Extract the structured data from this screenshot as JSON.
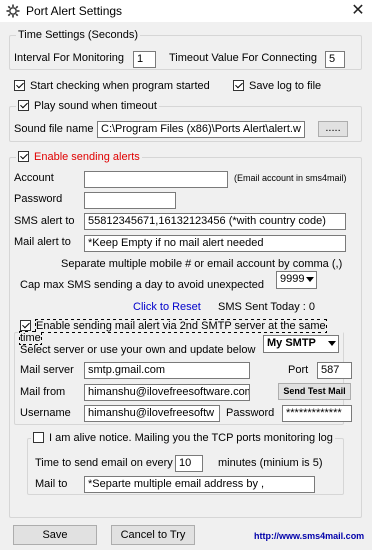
{
  "window": {
    "title": "Port Alert  Settings",
    "close_glyph": "✕"
  },
  "time_settings": {
    "legend": "Time Settings (Seconds)",
    "interval_label": "Interval For Monitoring",
    "interval_value": "1",
    "timeout_label": "Timeout Value For Connecting",
    "timeout_value": "5"
  },
  "options": {
    "start_checking_label": "Start checking when program started",
    "start_checking_checked": true,
    "save_log_label": "Save log to file",
    "save_log_checked": true
  },
  "sound": {
    "legend": "Play sound when timeout",
    "checked": true,
    "file_label": "Sound file name",
    "file_value": "C:\\Program Files (x86)\\Ports Alert\\alert.w",
    "browse_label": "....."
  },
  "alerts": {
    "legend": "Enable sending alerts",
    "checked": true,
    "account_label": "Account",
    "account_value": "",
    "account_hint": "(Email account in sms4mail)",
    "password_label": "Password",
    "password_value": "",
    "sms_label": "SMS alert to",
    "sms_value": "55812345671,16132123456 (*with country code)",
    "mail_label": "Mail alert to",
    "mail_value": "*Keep Empty if no mail alert needed",
    "separate_note": "Separate multiple mobile # or email account by comma (,)",
    "cap_label": "Cap max SMS sending a day to avoid unexpected",
    "cap_value": "9999",
    "reset_link": "Click to Reset",
    "sms_sent_label": "SMS Sent Today : 0"
  },
  "smtp": {
    "legend": "Enable sending mail alert via 2nd SMTP server at the same time",
    "checked": true,
    "select_label": "Select server or use your own and update below",
    "server_choice": "My SMTP",
    "server_label": "Mail server",
    "server_value": "smtp.gmail.com",
    "port_label": "Port",
    "port_value": "587",
    "from_label": "Mail from",
    "from_value": "himanshu@ilovefreesoftware.com",
    "test_button": "Send Test Mail",
    "username_label": "Username",
    "username_value": "himanshu@ilovefreesoftw",
    "password_label": "Password",
    "password_value": "*************"
  },
  "alive": {
    "legend": "I am alive notice. Mailing you the TCP ports monitoring log",
    "checked": false,
    "time_label": "Time to send email on every",
    "time_value": "10",
    "minutes_label": "minutes (minium is 5)",
    "mail_to_label": "Mail to",
    "mail_to_value": "*Separte multiple email address by ,"
  },
  "footer": {
    "save_label": "Save",
    "cancel_label": "Cancel to Try",
    "website": "http://www.sms4mail.com"
  }
}
